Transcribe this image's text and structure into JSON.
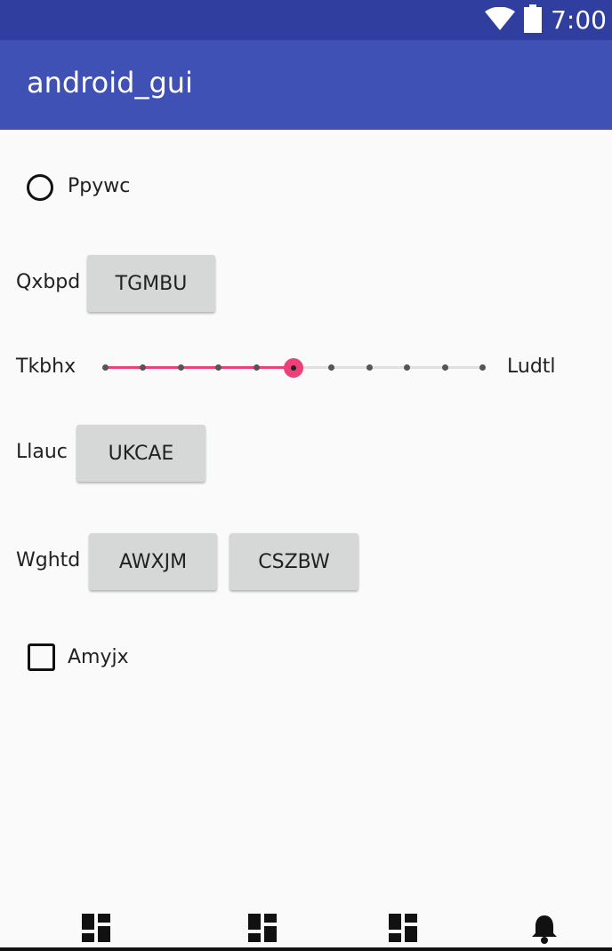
{
  "status_bar": {
    "time": "7:00",
    "icons": [
      "wifi-icon",
      "battery-icon"
    ]
  },
  "app_bar": {
    "title": "android_gui"
  },
  "radio": {
    "label": "Ppywc",
    "checked": false
  },
  "row_qxbpd": {
    "label": "Qxbpd",
    "button": "TGMBU"
  },
  "slider": {
    "left_label": "Tkbhx",
    "right_label": "Ludtl",
    "value": 5,
    "max": 10,
    "accent_color": "#ec407a"
  },
  "row_llauc": {
    "label": "Llauc",
    "button": "UKCAE"
  },
  "row_wghtd": {
    "label": "Wghtd",
    "buttons": [
      "AWXJM",
      "CSZBW"
    ]
  },
  "checkbox": {
    "label": "Amyjx",
    "checked": false
  },
  "bottom_nav": {
    "items": [
      "dashboard-icon",
      "dashboard-icon",
      "dashboard-icon",
      "bell-icon"
    ]
  },
  "colors": {
    "status_bar": "#303f9f",
    "app_bar": "#3f51b5",
    "button": "#d6d7d7",
    "background": "#fafafa"
  }
}
